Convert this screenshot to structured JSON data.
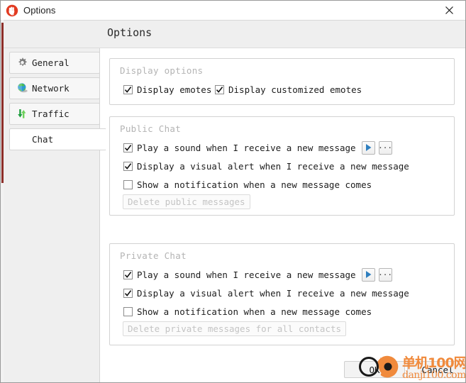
{
  "window": {
    "title": "Options",
    "app_icon": "app-logo-icon",
    "close_icon": "close-icon"
  },
  "header": {
    "title": "Options"
  },
  "sidebar": {
    "items": [
      {
        "label": "General",
        "icon": "gear-icon",
        "selected": false
      },
      {
        "label": "Network",
        "icon": "globe-icon",
        "selected": false
      },
      {
        "label": "Traffic",
        "icon": "traffic-arrows-icon",
        "selected": false
      },
      {
        "label": "Chat",
        "icon": "none",
        "selected": true
      }
    ]
  },
  "content": {
    "display_options": {
      "title": "Display options",
      "checkboxes": [
        {
          "label": "Display emotes",
          "checked": true
        },
        {
          "label": "Display customized emotes",
          "checked": true
        }
      ]
    },
    "public_chat": {
      "title": "Public Chat",
      "checkboxes": [
        {
          "label": "Play a sound when I receive a new message",
          "checked": true
        },
        {
          "label": "Display a visual alert when I receive a new message",
          "checked": true
        },
        {
          "label": "Show a notification when a new message comes",
          "checked": false
        }
      ],
      "play_button_icon": "play-icon",
      "browse_button_label": "...",
      "delete_button_label": "Delete public messages"
    },
    "private_chat": {
      "title": "Private Chat",
      "checkboxes": [
        {
          "label": "Play a sound when I receive a new message",
          "checked": true
        },
        {
          "label": "Display a visual alert when I receive a new message",
          "checked": true
        },
        {
          "label": "Show a notification when a new message comes",
          "checked": false
        }
      ],
      "play_button_icon": "play-icon",
      "browse_button_label": "...",
      "delete_button_label": "Delete private messages for all contacts"
    }
  },
  "footer": {
    "ok_label": "OK",
    "cancel_label": "Cancel"
  },
  "watermark": {
    "chinese": "单机100网",
    "english": "danji100.com",
    "color": "#f08a3c"
  },
  "colors": {
    "accent_orange": "#f08a3c",
    "play_blue": "#2f7fbf",
    "panel_bg": "#efefef",
    "content_bg": "#ffffff",
    "group_border": "#d2d2d2",
    "disabled_text": "#c4c4c4",
    "group_title": "#b4b4b4",
    "left_strip": "#8e2f2a"
  }
}
